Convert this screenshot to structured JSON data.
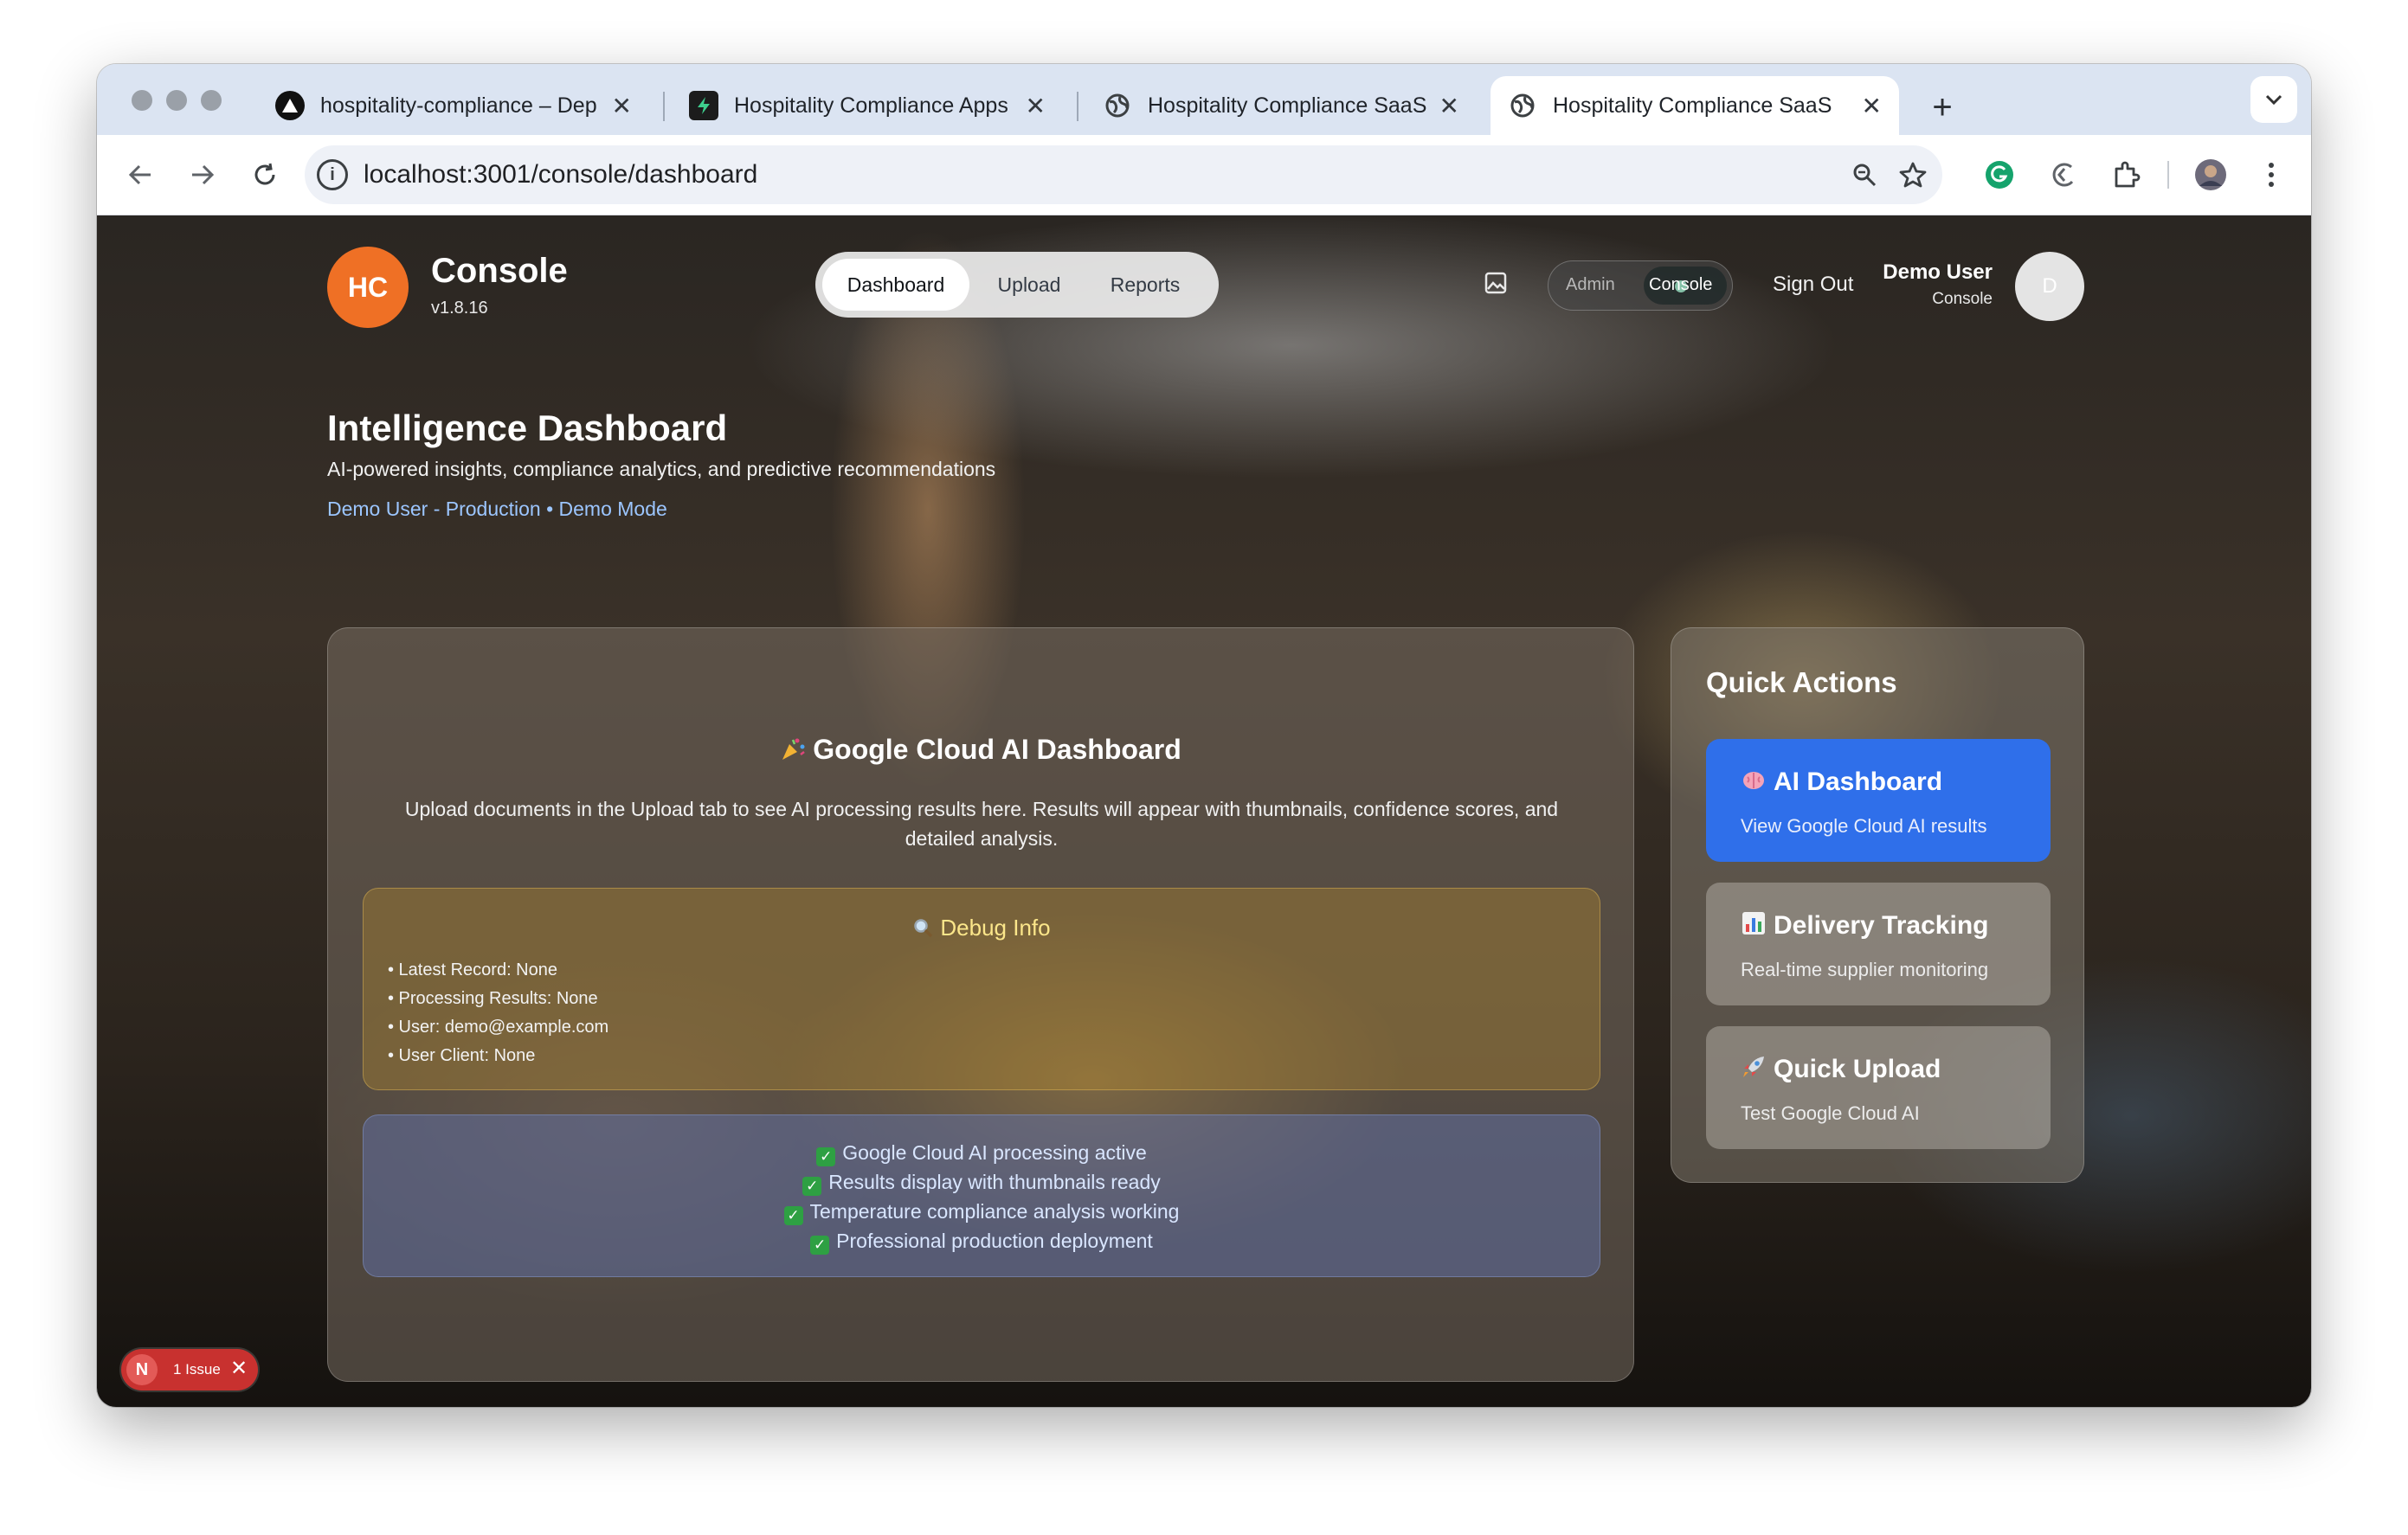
{
  "browser": {
    "tabs": [
      {
        "title": "hospitality-compliance – Dep",
        "icon": "vercel-icon",
        "active": false
      },
      {
        "title": "Hospitality Compliance Apps",
        "icon": "supabase-icon",
        "active": false
      },
      {
        "title": "Hospitality Compliance SaaS",
        "icon": "globe-icon",
        "active": false
      },
      {
        "title": "Hospitality Compliance SaaS",
        "icon": "globe-icon",
        "active": true
      }
    ],
    "tab_close_glyph": "✕",
    "new_tab_glyph": "+",
    "address": "localhost:3001/console/dashboard"
  },
  "header": {
    "logo_text": "HC",
    "app_title": "Console",
    "version": "v1.8.16",
    "nav": [
      {
        "label": "Dashboard",
        "active": true
      },
      {
        "label": "Upload",
        "active": false
      },
      {
        "label": "Reports",
        "active": false
      }
    ],
    "mode_toggle": {
      "left": "Admin",
      "right": "Console",
      "selected": "Console"
    },
    "sign_out": "Sign Out",
    "user_name": "Demo User",
    "user_role": "Console",
    "avatar_initial": "D"
  },
  "page": {
    "title": "Intelligence Dashboard",
    "subtitle": "AI-powered insights, compliance analytics, and predictive recommendations",
    "meta": "Demo User - Production • Demo Mode"
  },
  "main_card": {
    "title": "Google Cloud AI Dashboard",
    "description": "Upload documents in the Upload tab to see AI processing results here. Results will appear with thumbnails, confidence scores, and detailed analysis.",
    "debug": {
      "title": "Debug Info",
      "items": [
        "• Latest Record: None",
        "• Processing Results: None",
        "• User: demo@example.com",
        "• User Client: None"
      ]
    },
    "status_items": [
      "Google Cloud AI processing active",
      "Results display with thumbnails ready",
      "Temperature compliance analysis working",
      "Professional production deployment"
    ]
  },
  "quick_actions": {
    "title": "Quick Actions",
    "items": [
      {
        "title": "AI Dashboard",
        "subtitle": "View Google Cloud AI results",
        "icon": "brain-icon"
      },
      {
        "title": "Delivery Tracking",
        "subtitle": "Real-time supplier monitoring",
        "icon": "bar-chart-icon"
      },
      {
        "title": "Quick Upload",
        "subtitle": "Test Google Cloud AI",
        "icon": "rocket-icon"
      }
    ]
  },
  "dev_overlay": {
    "logo": "N",
    "issues_label": "1 Issue",
    "close_glyph": "✕"
  },
  "colors": {
    "accent_orange": "#ef7025",
    "primary_blue": "#2f6fea",
    "link_blue": "#9cc6ff",
    "issue_red": "#c8312f"
  }
}
